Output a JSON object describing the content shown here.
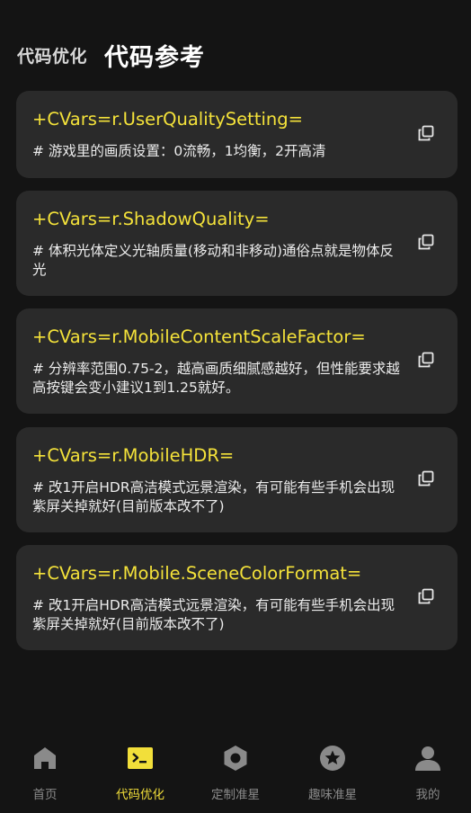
{
  "header": {
    "tab_optimize": "代码优化",
    "tab_reference": "代码参考"
  },
  "cards": [
    {
      "code": "+CVars=r.UserQualitySetting=",
      "desc": "# 游戏里的画质设置：0流畅，1均衡，2开高清"
    },
    {
      "code": "+CVars=r.ShadowQuality=",
      "desc": "# 体积光体定义光轴质量(移动和非移动)通俗点就是物体反光"
    },
    {
      "code": "+CVars=r.MobileContentScaleFactor=",
      "desc": "# 分辨率范围0.75-2，越高画质细腻感越好，但性能要求越高按键会变小建议1到1.25就好。"
    },
    {
      "code": "+CVars=r.MobileHDR=",
      "desc": "# 改1开启HDR高洁模式远景渲染，有可能有些手机会出现紫屏关掉就好(目前版本改不了)"
    },
    {
      "code": "+CVars=r.Mobile.SceneColorFormat=",
      "desc": "# 改1开启HDR高洁模式远景渲染，有可能有些手机会出现紫屏关掉就好(目前版本改不了)"
    }
  ],
  "nav": {
    "items": [
      {
        "label": "首页",
        "icon": "home-icon"
      },
      {
        "label": "代码优化",
        "icon": "terminal-icon"
      },
      {
        "label": "定制准星",
        "icon": "hexagon-icon"
      },
      {
        "label": "趣味准星",
        "icon": "star-icon"
      },
      {
        "label": "我的",
        "icon": "person-icon"
      }
    ],
    "active_index": 1,
    "active_color": "#f2df3a",
    "inactive_color": "#8a8a8a"
  },
  "colors": {
    "background": "#141414",
    "card": "#2a2a2a",
    "code_text": "#f4e23a"
  }
}
